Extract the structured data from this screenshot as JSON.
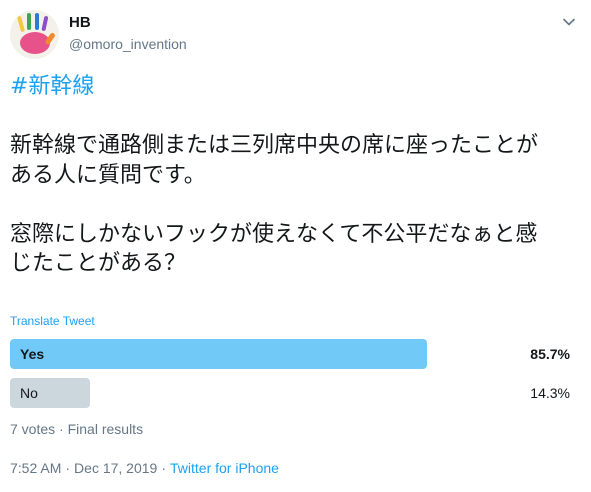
{
  "author": {
    "name": "HB",
    "handle": "@omoro_invention"
  },
  "icons": {
    "avatar": "handprint-avatar",
    "caret": "chevron-down-icon"
  },
  "tweet": {
    "hashtag": "#新幹線",
    "lines": [
      "新幹線で通路側または三列席中央の席に座ったことが",
      "ある人に質問です。",
      "窓際にしかないフックが使えなくて不公平だなぁと感",
      "じたことがある？"
    ]
  },
  "translate_label": "Translate Tweet",
  "poll": {
    "options": [
      {
        "label": "Yes",
        "percent_text": "85.7%",
        "percent": 85.7
      },
      {
        "label": "No",
        "percent_text": "14.3%",
        "percent": 14.3
      }
    ],
    "votes_text": "7 votes",
    "status_text": "Final results"
  },
  "meta": {
    "time": "7:52 AM",
    "date": "Dec 17, 2019",
    "source": "Twitter for iPhone"
  },
  "colors": {
    "accent": "#1da1f2",
    "winning_bar": "#71c9f8",
    "losing_bar": "#ccd6dd",
    "secondary_text": "#657786"
  }
}
